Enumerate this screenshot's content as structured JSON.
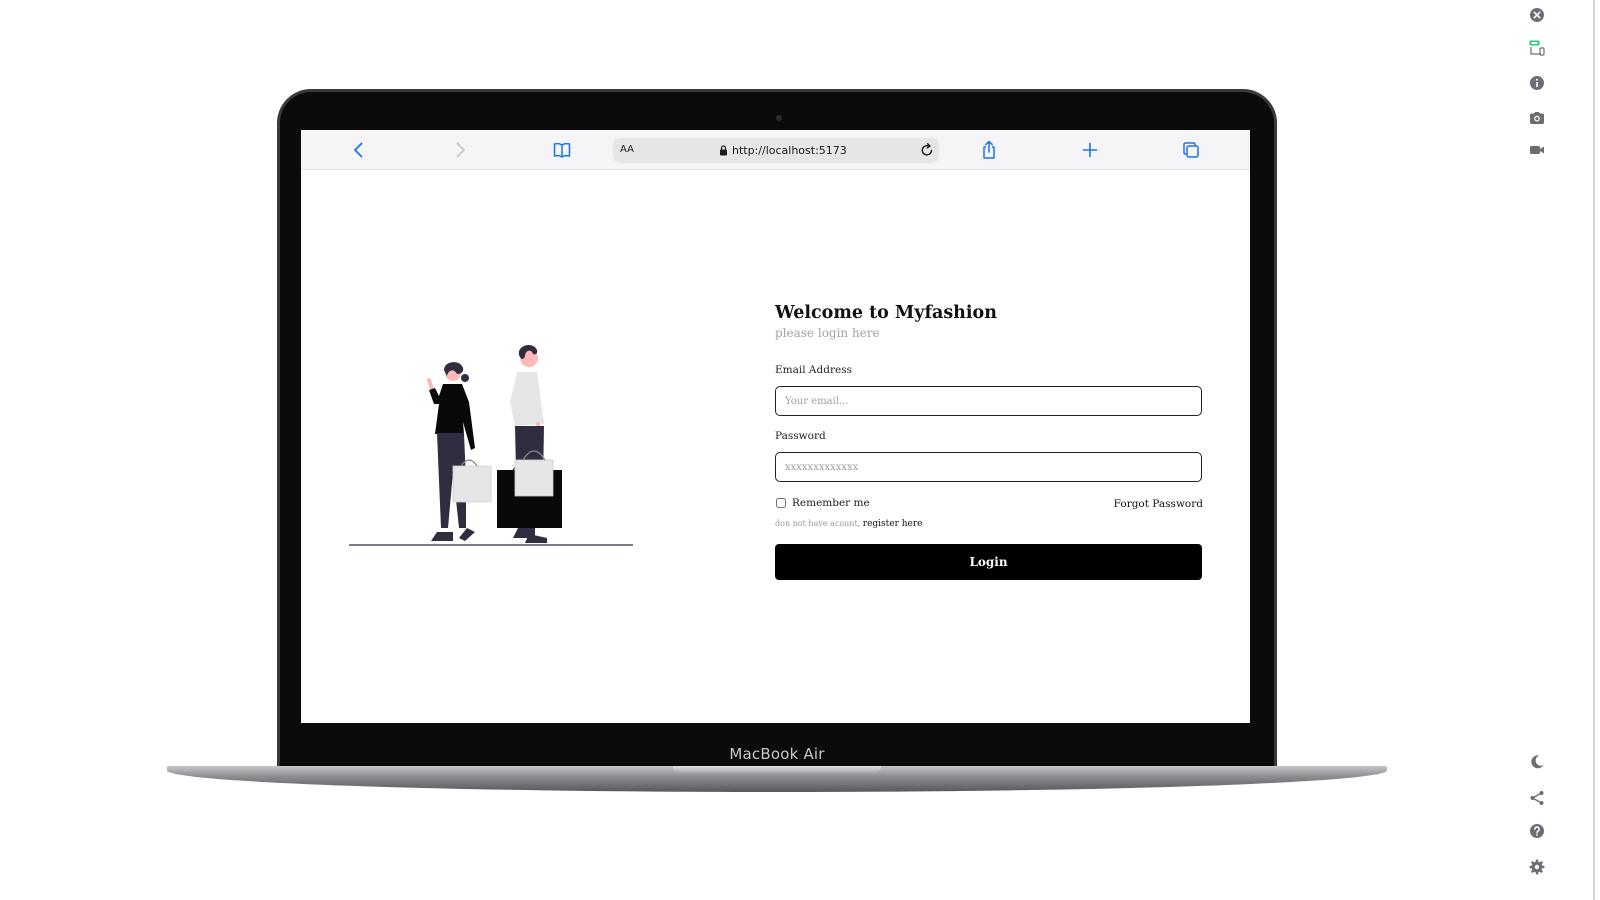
{
  "device": {
    "model_label": "MacBook Air"
  },
  "browser": {
    "text_size_label": "AA",
    "url": "http://localhost:5173",
    "icons": [
      "back-icon",
      "forward-icon",
      "bookmarks-icon",
      "lock-icon",
      "reload-icon",
      "share-icon",
      "new-tab-icon",
      "tabs-icon"
    ]
  },
  "simulator_toolbar": {
    "icons": [
      "close-icon",
      "device-toggle-icon",
      "info-icon",
      "screenshot-icon",
      "record-video-icon",
      "dark-mode-icon",
      "share-icon",
      "help-icon",
      "settings-icon"
    ]
  },
  "login": {
    "title": "Welcome to Myfashion",
    "subtitle": "please login here",
    "email": {
      "label": "Email Address",
      "placeholder": "Your email...",
      "value": ""
    },
    "password": {
      "label": "Password",
      "placeholder": "xxxxxxxxxxxxx",
      "value": ""
    },
    "remember_label": "Remember me",
    "forgot_label": "Forgot Password",
    "no_account_text": "don not have acount,",
    "register_label": "register here",
    "submit_label": "Login"
  },
  "colors": {
    "primary_button": "#000000",
    "browser_accent": "#1a73e8",
    "placeholder_text": "#a0a0a0"
  }
}
